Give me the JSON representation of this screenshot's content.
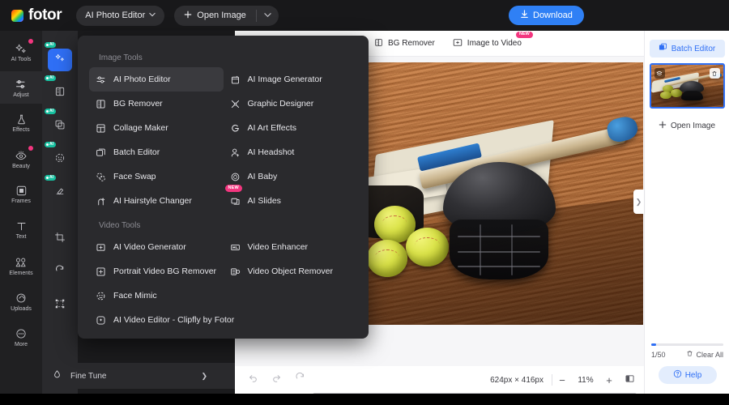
{
  "topbar": {
    "logo_text": "fotor",
    "logo_icon": "fotor-gradient-logo",
    "app_selector_label": "AI Photo Editor",
    "app_selector_icon": "chevron-down-icon",
    "open_image_label": "Open Image",
    "open_image_icon": "plus-icon",
    "open_image_caret_icon": "chevron-down-icon",
    "download_label": "Download",
    "download_icon": "download-icon",
    "download_color": "#2f80f5"
  },
  "rail": {
    "items": [
      {
        "label": "AI Tools",
        "icon": "sparkle-icon",
        "badge": true,
        "active": false
      },
      {
        "label": "Adjust",
        "icon": "sliders-icon",
        "badge": false,
        "active": true
      },
      {
        "label": "Effects",
        "icon": "flask-icon",
        "badge": false,
        "active": false
      },
      {
        "label": "Beauty",
        "icon": "eye-icon",
        "badge": true,
        "active": false
      },
      {
        "label": "Frames",
        "icon": "frame-icon",
        "badge": false,
        "active": false
      },
      {
        "label": "Text",
        "icon": "text-t-icon",
        "badge": false,
        "active": false
      },
      {
        "label": "Elements",
        "icon": "shapes-icon",
        "badge": false,
        "active": false
      },
      {
        "label": "Uploads",
        "icon": "cloud-up-icon",
        "badge": false,
        "active": false
      },
      {
        "label": "More",
        "icon": "more-circle-icon",
        "badge": false,
        "active": false
      }
    ]
  },
  "toolcolumn": {
    "ai_badge_text": "AI",
    "items": [
      {
        "icon": "ai-enhance-icon",
        "ai": true,
        "selected": true
      },
      {
        "icon": "ai-bg-remover-icon",
        "ai": true,
        "selected": false
      },
      {
        "icon": "ai-expand-icon",
        "ai": true,
        "selected": false
      },
      {
        "icon": "ai-retouch-icon",
        "ai": true,
        "selected": false
      },
      {
        "icon": "ai-object-remove-icon",
        "ai": true,
        "selected": false
      },
      {
        "icon": "crop-icon",
        "ai": false,
        "selected": false
      },
      {
        "icon": "rotate-icon",
        "ai": false,
        "selected": false
      },
      {
        "icon": "resize-icon",
        "ai": false,
        "selected": false
      },
      {
        "icon": "adjust-sliders-icon",
        "ai": false,
        "selected": false
      }
    ],
    "fine_tune_label": "Fine Tune",
    "fine_tune_icon": "droplet-icon",
    "fine_tune_chevron": "chevron-right-icon"
  },
  "menu": {
    "image_tools_heading": "Image Tools",
    "video_tools_heading": "Video Tools",
    "new_badge_text": "NEW",
    "image_tools_left": [
      {
        "label": "AI Photo Editor",
        "icon": "sliders-icon",
        "highlighted": true,
        "new": false
      },
      {
        "label": "BG Remover",
        "icon": "bg-remover-icon",
        "highlighted": false,
        "new": false
      },
      {
        "label": "Collage Maker",
        "icon": "collage-icon",
        "highlighted": false,
        "new": false
      },
      {
        "label": "Batch Editor",
        "icon": "batch-icon",
        "highlighted": false,
        "new": false
      },
      {
        "label": "Face Swap",
        "icon": "face-swap-icon",
        "highlighted": false,
        "new": false
      },
      {
        "label": "AI Hairstyle Changer",
        "icon": "hairstyle-icon",
        "highlighted": false,
        "new": false
      }
    ],
    "image_tools_right": [
      {
        "label": "AI Image Generator",
        "icon": "image-gen-icon",
        "highlighted": false,
        "new": false
      },
      {
        "label": "Graphic Designer",
        "icon": "graphic-design-icon",
        "highlighted": false,
        "new": false
      },
      {
        "label": "AI Art Effects",
        "icon": "art-effects-icon",
        "highlighted": false,
        "new": false
      },
      {
        "label": "AI Headshot",
        "icon": "headshot-icon",
        "highlighted": false,
        "new": false
      },
      {
        "label": "AI Baby",
        "icon": "ai-baby-icon",
        "highlighted": false,
        "new": false
      },
      {
        "label": "AI Slides",
        "icon": "ai-slides-icon",
        "highlighted": false,
        "new": true
      }
    ],
    "video_tools_left": [
      {
        "label": "AI Video Generator",
        "icon": "video-gen-icon",
        "highlighted": false,
        "new": false
      },
      {
        "label": "Portrait Video BG Remover",
        "icon": "portrait-bg-icon",
        "highlighted": false,
        "new": false
      },
      {
        "label": "Face Mimic",
        "icon": "face-mimic-icon",
        "highlighted": false,
        "new": false
      },
      {
        "label": "AI Video Editor - Clipfly by Fotor",
        "icon": "clipfly-icon",
        "highlighted": false,
        "new": false
      }
    ],
    "video_tools_right": [
      {
        "label": "Video Enhancer",
        "icon": "video-enhance-icon",
        "highlighted": false,
        "new": false
      },
      {
        "label": "Video Object Remover",
        "icon": "video-object-icon",
        "highlighted": false,
        "new": false
      }
    ]
  },
  "worktop": {
    "items": [
      {
        "label": "BG Remover",
        "icon": "bg-remover-icon",
        "new": false
      },
      {
        "label": "Image to Video",
        "icon": "img2video-icon",
        "new": true
      }
    ],
    "new_badge_text": "NEW"
  },
  "canvas": {
    "image_alt": "softball helmet bat and balls on infield dirt",
    "collapse_icon": "chevron-right-icon"
  },
  "bottombar": {
    "undo_icon": "undo-icon",
    "redo_icon": "redo-icon",
    "reset_icon": "reset-icon",
    "dimensions": "624px × 416px",
    "zoom_out_label": "−",
    "zoom_value": "11%",
    "zoom_in_label": "+",
    "fit_icon": "fit-screen-icon"
  },
  "rightpanel": {
    "batch_editor_label": "Batch Editor",
    "batch_editor_icon": "batch-editor-icon",
    "thumb_layers_icon": "layers-icon",
    "thumb_delete_icon": "trash-icon",
    "open_image_label": "Open Image",
    "open_image_icon": "plus-icon",
    "count_label": "1/50",
    "clear_all_label": "Clear All",
    "clear_all_icon": "trash-icon",
    "help_label": "Help",
    "help_icon": "question-circle-icon",
    "accent_color": "#2f6ff5"
  }
}
